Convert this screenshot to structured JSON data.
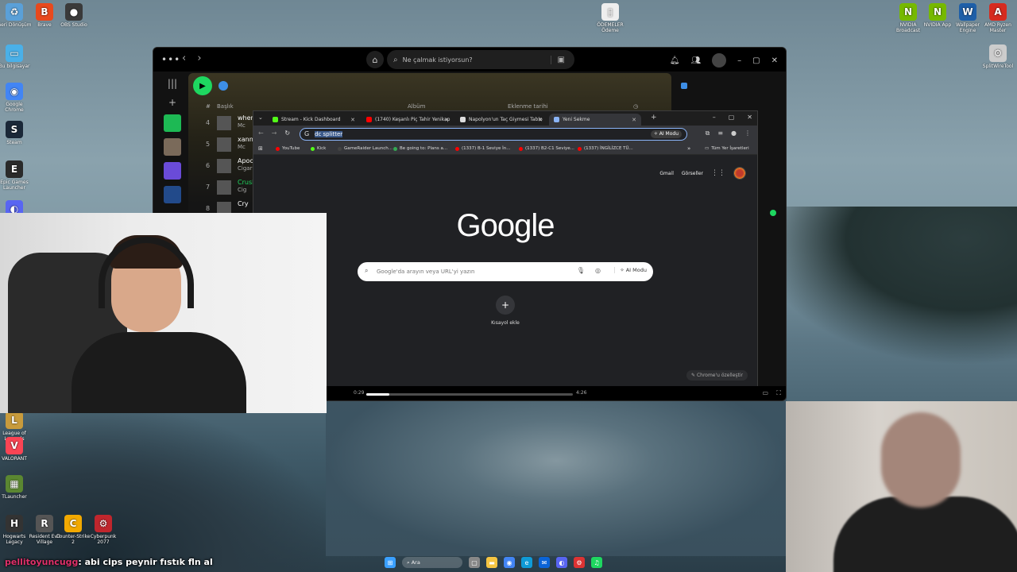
{
  "desktop": {
    "icons_left": [
      {
        "label": "Geri Dönüşüm",
        "color": "#5aa0d8",
        "glyph": "♻"
      },
      {
        "label": "Brave",
        "color": "#e8491d",
        "glyph": "B"
      },
      {
        "label": "OBS Studio",
        "color": "#3a3a3a",
        "glyph": "●"
      },
      {
        "label": "Bu bilgisayar",
        "color": "#4ab0e8",
        "glyph": "▭"
      },
      {
        "label": "Google Chrome",
        "color": "#4285f4",
        "glyph": "◉"
      },
      {
        "label": "Steam",
        "color": "#1b2838",
        "glyph": "S"
      },
      {
        "label": "Epic Games Launcher",
        "color": "#2a2a2a",
        "glyph": "E"
      },
      {
        "label": "",
        "color": "#5865f2",
        "glyph": "◐"
      },
      {
        "label": "League of Legends",
        "color": "#c89b3c",
        "glyph": "L"
      },
      {
        "label": "VALORANT",
        "color": "#fa4454",
        "glyph": "V"
      },
      {
        "label": "TLauncher",
        "color": "#5b8731",
        "glyph": "▦"
      },
      {
        "label": "Hogwarts Legacy",
        "color": "#333",
        "glyph": "H"
      },
      {
        "label": "Resident Evil Village",
        "color": "#555",
        "glyph": "R"
      },
      {
        "label": "Counter-Strike 2",
        "color": "#f2a900",
        "glyph": "C"
      },
      {
        "label": "Cyberpunk 2077",
        "color": "#c0262d",
        "glyph": "⚙"
      }
    ],
    "icons_top_center": [
      {
        "label": "ÖDEMELER Ödeme",
        "color": "#eeeeee",
        "glyph": "▯"
      }
    ],
    "icons_right": [
      {
        "label": "NVIDIA Broadcast",
        "color": "#76b900",
        "glyph": "N"
      },
      {
        "label": "NVIDIA App",
        "color": "#76b900",
        "glyph": "N"
      },
      {
        "label": "Wallpaper Engine",
        "color": "#1e5fa8",
        "glyph": "W"
      },
      {
        "label": "AMD Ryzen Master",
        "color": "#d62b1f",
        "glyph": "A"
      },
      {
        "label": "SplitWireTool",
        "color": "#cccccc",
        "glyph": "⚙"
      }
    ]
  },
  "spotify": {
    "search_placeholder": "Ne çalmak istiyorsun?",
    "columns": {
      "num": "#",
      "title": "Başlık",
      "album": "Albüm",
      "added": "Eklenme tarihi"
    },
    "tracks": [
      {
        "num": "4",
        "title": "when",
        "artist": "Mc"
      },
      {
        "num": "5",
        "title": "xanny",
        "artist": "Mc"
      },
      {
        "num": "6",
        "title": "Apoc",
        "artist": "Cigar"
      },
      {
        "num": "7",
        "title": "Crush",
        "artist": "Cig"
      },
      {
        "num": "8",
        "title": "Cry",
        "artist": ""
      }
    ],
    "time_elapsed": "0:29",
    "time_total": "4:26",
    "progress": 0.11,
    "accent": "#1ed760"
  },
  "chrome": {
    "tabs": [
      {
        "label": "Stream - Kick Dashboard",
        "color": "#53fc18",
        "active": false
      },
      {
        "label": "(1740) Keşanlı Piç Tahir Yenikap",
        "color": "#ff0000",
        "active": false
      },
      {
        "label": "Napolyon'un Taç Giymesi Tablo",
        "color": "#dddddd",
        "active": false
      },
      {
        "label": "Yeni Sekme",
        "color": "#8ab4f8",
        "active": true
      }
    ],
    "omnibox_text": "dc splitter",
    "ai_mode": "AI Modu",
    "bookmarks": [
      {
        "label": "YouTube",
        "color": "#ff0000"
      },
      {
        "label": "Kick",
        "color": "#53fc18"
      },
      {
        "label": "GameRaider Launch...",
        "color": "#444"
      },
      {
        "label": "Be going to: Plans a...",
        "color": "#34a853"
      },
      {
        "label": "(1337) B-1 Seviye İn...",
        "color": "#ff0000"
      },
      {
        "label": "(1337) B2-C1 Seviye...",
        "color": "#ff0000"
      },
      {
        "label": "(1337) İNGİLİZCE TÜ...",
        "color": "#ff0000"
      }
    ],
    "all_bookmarks": "Tüm Yer İşaretleri",
    "gmail": "Gmail",
    "images": "Görseller",
    "logo": "Google",
    "search_placeholder": "Google'da arayın veya URL'yi yazın",
    "search_ai_mode": "AI Modu",
    "add_shortcut": "Kısayol ekle",
    "customize": "Chrome'u özelleştir"
  },
  "chat": {
    "user": "pellitoyuncugg",
    "message": ": abi cips peynir fıstık fln al"
  },
  "taskbar": {
    "search_label": "Ara",
    "icons": [
      {
        "name": "start-icon",
        "glyph": "⊞",
        "color": "#3aa0ff"
      },
      {
        "name": "taskview-icon",
        "glyph": "▢",
        "color": "#888"
      },
      {
        "name": "explorer-icon",
        "glyph": "▬",
        "color": "#f5c542"
      },
      {
        "name": "chrome-icon",
        "glyph": "◉",
        "color": "#4285f4"
      },
      {
        "name": "edge-icon",
        "glyph": "e",
        "color": "#0f9bd7"
      },
      {
        "name": "mail-icon",
        "glyph": "✉",
        "color": "#0a64d8"
      },
      {
        "name": "discord-icon",
        "glyph": "◐",
        "color": "#5865f2"
      },
      {
        "name": "gear-app-icon",
        "glyph": "⚙",
        "color": "#d33"
      },
      {
        "name": "spotify-icon",
        "glyph": "♫",
        "color": "#1ed760"
      }
    ]
  }
}
